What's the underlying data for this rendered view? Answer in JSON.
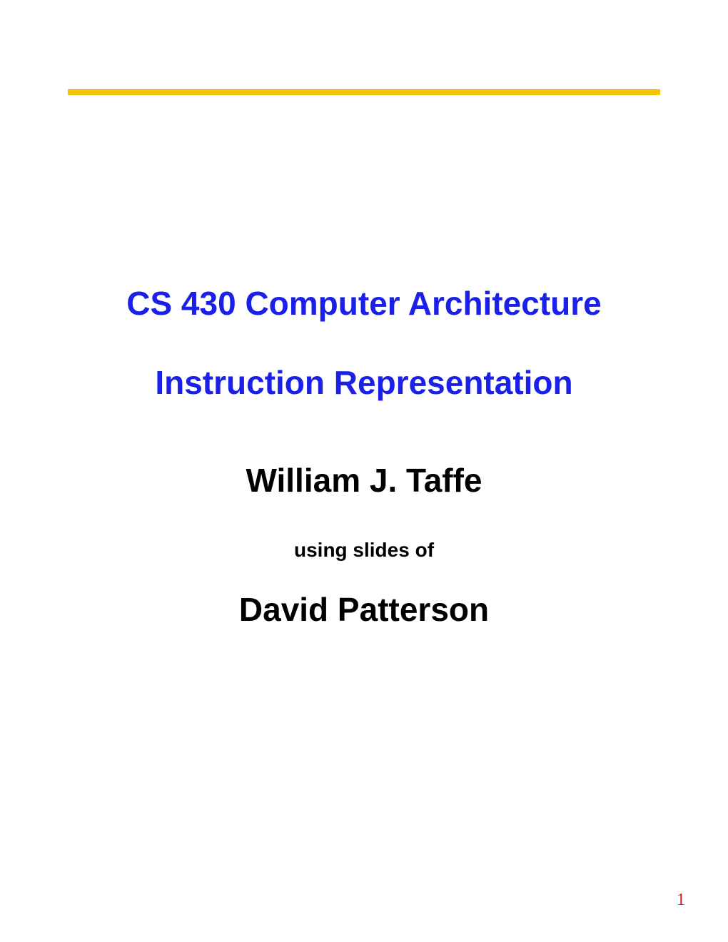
{
  "slide": {
    "title_line1": "CS 430 Computer Architecture",
    "title_line2": "Instruction Representation",
    "author_primary": "William J. Taffe",
    "credit_label": "using slides of",
    "author_secondary": "David Patterson",
    "page_number": "1"
  },
  "colors": {
    "title_blue": "#1a20e8",
    "rule_yellow": "#f4c400",
    "pagenum_red": "#d11a1a"
  }
}
